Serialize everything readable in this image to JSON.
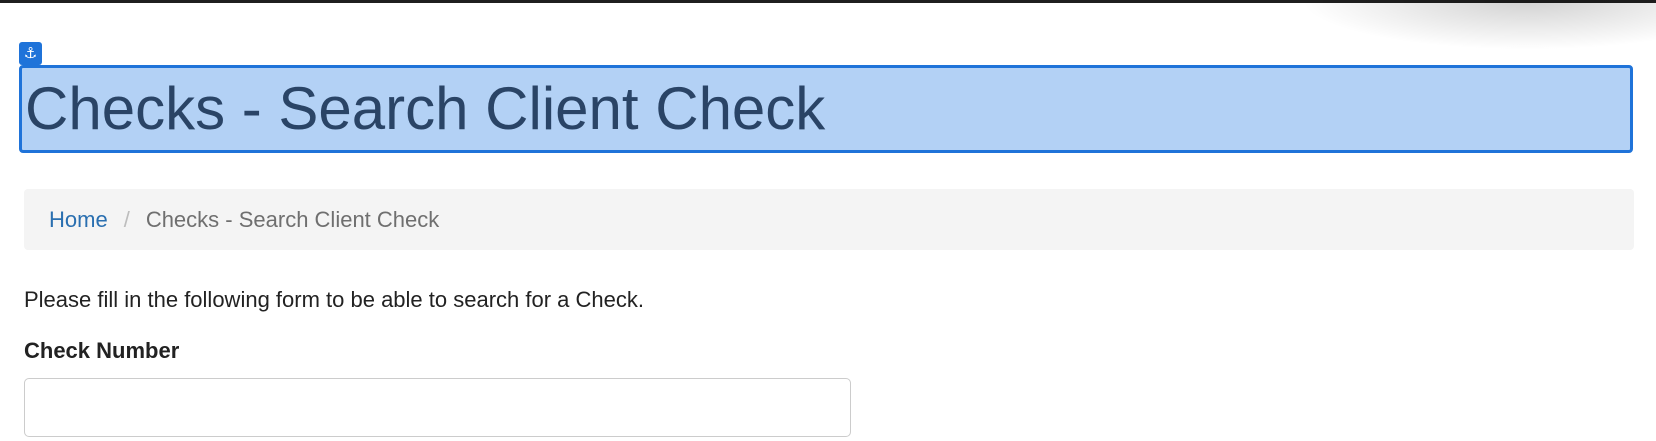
{
  "header": {
    "anchor_icon": "anchor-icon",
    "title": "Checks - Search Client Check",
    "highlight_color": "#b3d1f5",
    "highlight_border": "#1f73d9"
  },
  "breadcrumb": {
    "items": [
      {
        "label": "Home",
        "link": true
      },
      {
        "label": "Checks - Search Client Check",
        "link": false
      }
    ],
    "separator": "/",
    "link_color": "#2a6fb0"
  },
  "main": {
    "intro": "Please fill in the following form to be able to search for a Check.",
    "fields": [
      {
        "label": "Check Number",
        "value": "",
        "placeholder": ""
      }
    ]
  }
}
